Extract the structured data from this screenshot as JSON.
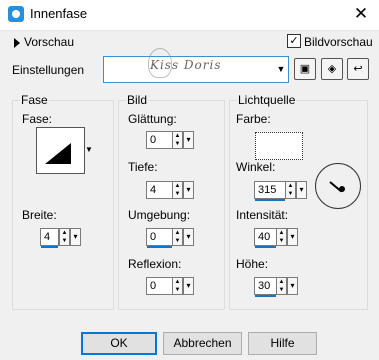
{
  "window": {
    "title": "Innenfase",
    "close_glyph": "✕"
  },
  "preview": {
    "label": "Vorschau",
    "checkbox_label": "Bildvorschau",
    "checkbox_checked": true
  },
  "settings": {
    "label": "Einstellungen",
    "preset_value": "",
    "watermark": "Kiss Doris"
  },
  "groups": {
    "fase": {
      "title": "Fase",
      "fase_label": "Fase:",
      "breite_label": "Breite:",
      "breite_value": "4"
    },
    "bild": {
      "title": "Bild",
      "glaettung_label": "Glättung:",
      "glaettung_value": "0",
      "tiefe_label": "Tiefe:",
      "tiefe_value": "4",
      "umgebung_label": "Umgebung:",
      "umgebung_value": "0",
      "reflexion_label": "Reflexion:",
      "reflexion_value": "0"
    },
    "lichtquelle": {
      "title": "Lichtquelle",
      "farbe_label": "Farbe:",
      "winkel_label": "Winkel:",
      "winkel_value": "315",
      "intensitaet_label": "Intensität:",
      "intensitaet_value": "40",
      "hoehe_label": "Höhe:",
      "hoehe_value": "30"
    }
  },
  "buttons": {
    "ok": "OK",
    "cancel": "Abbrechen",
    "help": "Hilfe"
  },
  "colors": {
    "accent": "#1e73be",
    "background": "#f0f0f0"
  }
}
